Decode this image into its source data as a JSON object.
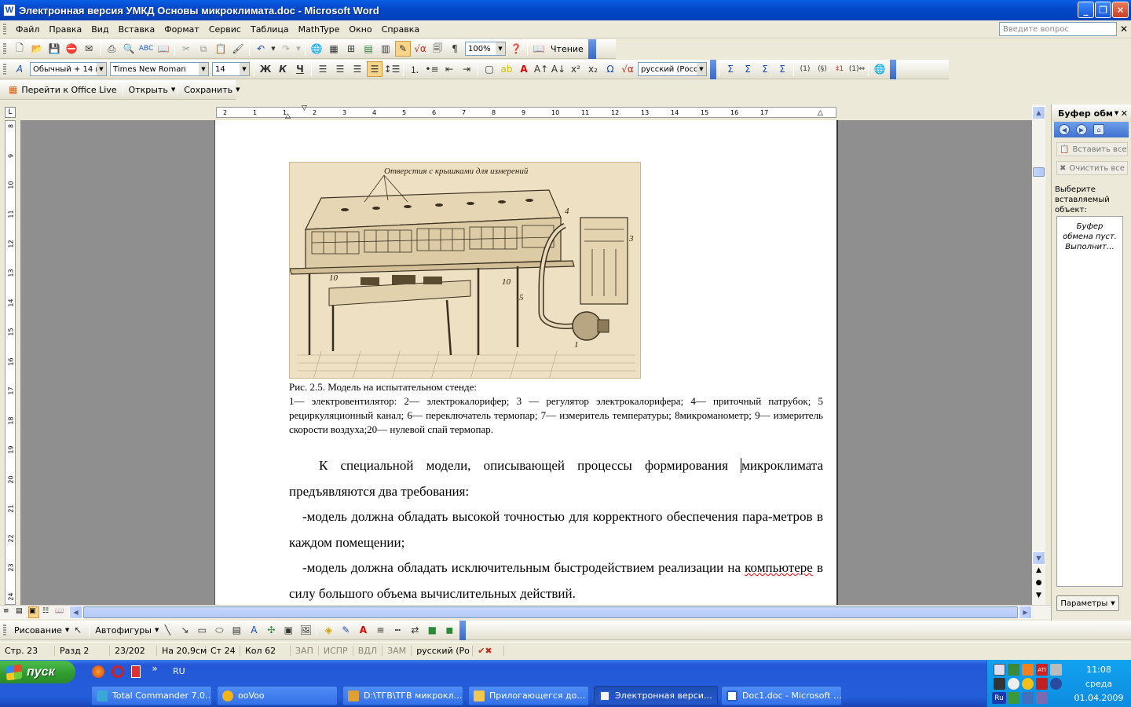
{
  "window": {
    "title": "Электронная версия УМКД Основы микроклимата.doc - Microsoft Word",
    "icon": "word-doc-icon"
  },
  "menu": {
    "items": [
      "Файл",
      "Правка",
      "Вид",
      "Вставка",
      "Формат",
      "Сервис",
      "Таблица",
      "MathType",
      "Окно",
      "Справка"
    ],
    "ask_placeholder": "Введите вопрос"
  },
  "toolbar_standard": {
    "zoom": "100%",
    "reading": "Чтение"
  },
  "toolbar_format": {
    "style": "Обычный + 14 г",
    "font": "Times New Roman",
    "size": "14",
    "bold": "Ж",
    "italic": "К",
    "underline": "Ч",
    "language": "русский (Росс",
    "omega": "Ω"
  },
  "toolbar_live": {
    "goto": "Перейти к Office Live",
    "open": "Открыть",
    "save": "Сохранить"
  },
  "ruler": {
    "h_labels": [
      "2",
      "1",
      "",
      "1",
      "2",
      "3",
      "4",
      "5",
      "6",
      "7",
      "8",
      "9",
      "10",
      "11",
      "12",
      "13",
      "14",
      "15",
      "16",
      "17"
    ],
    "v_labels": [
      "8",
      "9",
      "10",
      "11",
      "12",
      "13",
      "14",
      "15",
      "16",
      "17",
      "18",
      "19",
      "20",
      "21",
      "22",
      "23",
      "24"
    ]
  },
  "document": {
    "figure_label": "Отверстия с крышками для измерений",
    "figure_numbers": [
      "4",
      "3",
      "10",
      "10",
      "5",
      "1"
    ],
    "caption_title": "Рис. 2.5. Модель на испытательном стенде:",
    "caption_legend": "1— электровентилятор: 2— электрокалорифер; 3 — регулятор электрокалорифера; 4— приточный патрубок; 5 рециркуляционный канал; 6— переключатель термопар; 7— измеритель температуры; 8микроманометр; 9— измеритель скорости воздуха;20— нулевой спай термопар.",
    "para1_a": "К   специальной модели, описывающей процессы формирования ",
    "para1_b": "микроклимата предъявляются два требования:",
    "para2": "-модель должна обладать высокой точностью для корректного обеспечения пара-метров в каждом помещении;",
    "para3_a": "-модель должна обладать исключительным быстродействием реализации на ",
    "para3_b": "компьютере",
    "para3_c": " в силу большого объема вычислительных действий."
  },
  "taskpane": {
    "title": "Буфер обм",
    "paste_all": "Вставить все",
    "clear_all": "Очистить все",
    "hint": "Выберите вставляемый объект:",
    "empty": "Буфер обмена пуст. Выполнит…",
    "params": "Параметры"
  },
  "drawbar": {
    "drawing": "Рисование",
    "autoshapes": "Автофигуры"
  },
  "status": {
    "page": "Стр. 23",
    "section": "Разд 2",
    "pages": "23/202",
    "at": "На 20,9см",
    "line": "Ст 24",
    "col": "Кол 62",
    "rec": "ЗАП",
    "trk": "ИСПР",
    "ext": "ВДЛ",
    "ovr": "ЗАМ",
    "lang": "русский (Ро"
  },
  "taskbar": {
    "start": "пуск",
    "lang": "RU",
    "tasks": [
      {
        "label": "Total Commander 7.0…",
        "color": "#3aa7d8"
      },
      {
        "label": "ooVoo",
        "color": "#f2b418"
      },
      {
        "label": "D:\\ТГВ\\ТГВ микрокл…",
        "color": "#e0a030"
      },
      {
        "label": "Прилогающегся до…",
        "color": "#f0c850"
      },
      {
        "label": "Электронная верси…",
        "color": "#2a5bd7"
      },
      {
        "label": "Doc1.doc - Microsoft …",
        "color": "#2a5bd7"
      }
    ],
    "clock_time": "11:08",
    "clock_day": "среда",
    "clock_date": "01.04.2009",
    "tray_lang": "Ru"
  }
}
